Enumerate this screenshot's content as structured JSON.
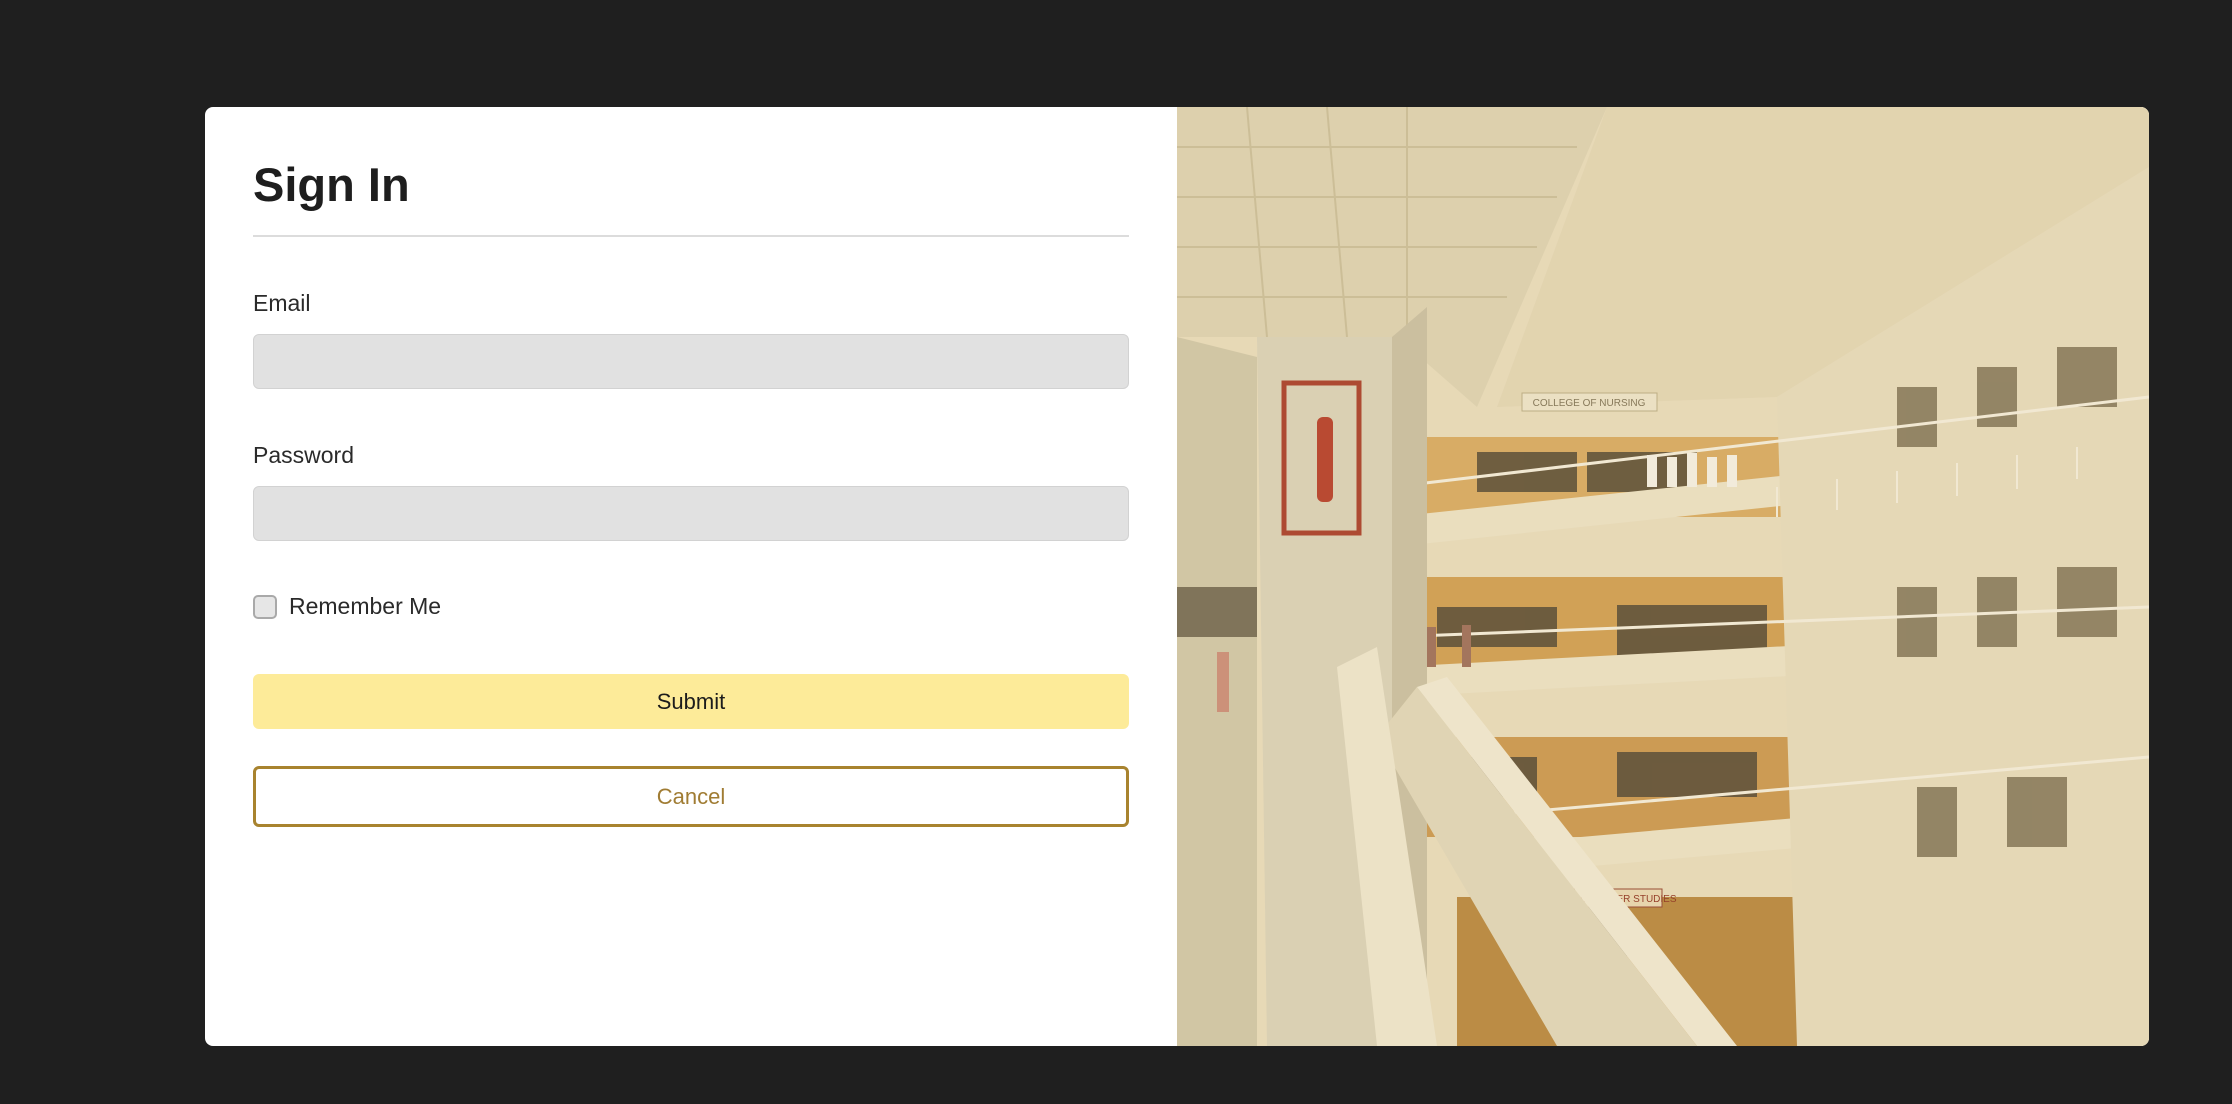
{
  "signin": {
    "title": "Sign In",
    "email": {
      "label": "Email",
      "value": "",
      "placeholder": ""
    },
    "password": {
      "label": "Password",
      "value": "",
      "placeholder": ""
    },
    "remember_label": "Remember Me",
    "remember_checked": false,
    "submit_label": "Submit",
    "cancel_label": "Cancel"
  },
  "photo": {
    "signs": [
      "COLLEGE OF NURSING",
      "LLEGE OF COMPUTER STUDIES"
    ]
  },
  "colors": {
    "background": "#1f1f1f",
    "submit_bg": "#fdeb99",
    "cancel_border": "#a8832f",
    "cancel_text": "#a07c33",
    "field_bg": "#e1e1e1"
  }
}
